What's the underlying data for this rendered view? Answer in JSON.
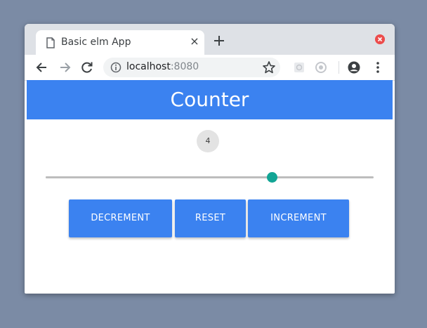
{
  "browser": {
    "tab_title": "Basic elm App",
    "tab_close_symbol": "×",
    "url_host": "localhost",
    "url_port": ":8080",
    "icons": {
      "favicon": "document-icon",
      "tab_close": "close-icon",
      "new_tab": "plus-icon",
      "window_close": "window-close-icon",
      "back": "back-arrow-icon",
      "forward": "forward-arrow-icon",
      "reload": "reload-icon",
      "site_info": "info-icon",
      "bookmark": "star-icon",
      "extension1": "extension-icon",
      "extension2": "extension-icon",
      "profile": "account-icon",
      "menu": "kebab-menu-icon"
    }
  },
  "app": {
    "title": "Counter",
    "counter_value": "4",
    "slider": {
      "fraction": 0.69
    },
    "buttons": {
      "decrement": "DECREMENT",
      "reset": "RESET",
      "increment": "INCREMENT"
    }
  },
  "colors": {
    "primary": "#3b82f0",
    "slider_thumb": "#12a595",
    "desktop": "#7b8ba5"
  }
}
